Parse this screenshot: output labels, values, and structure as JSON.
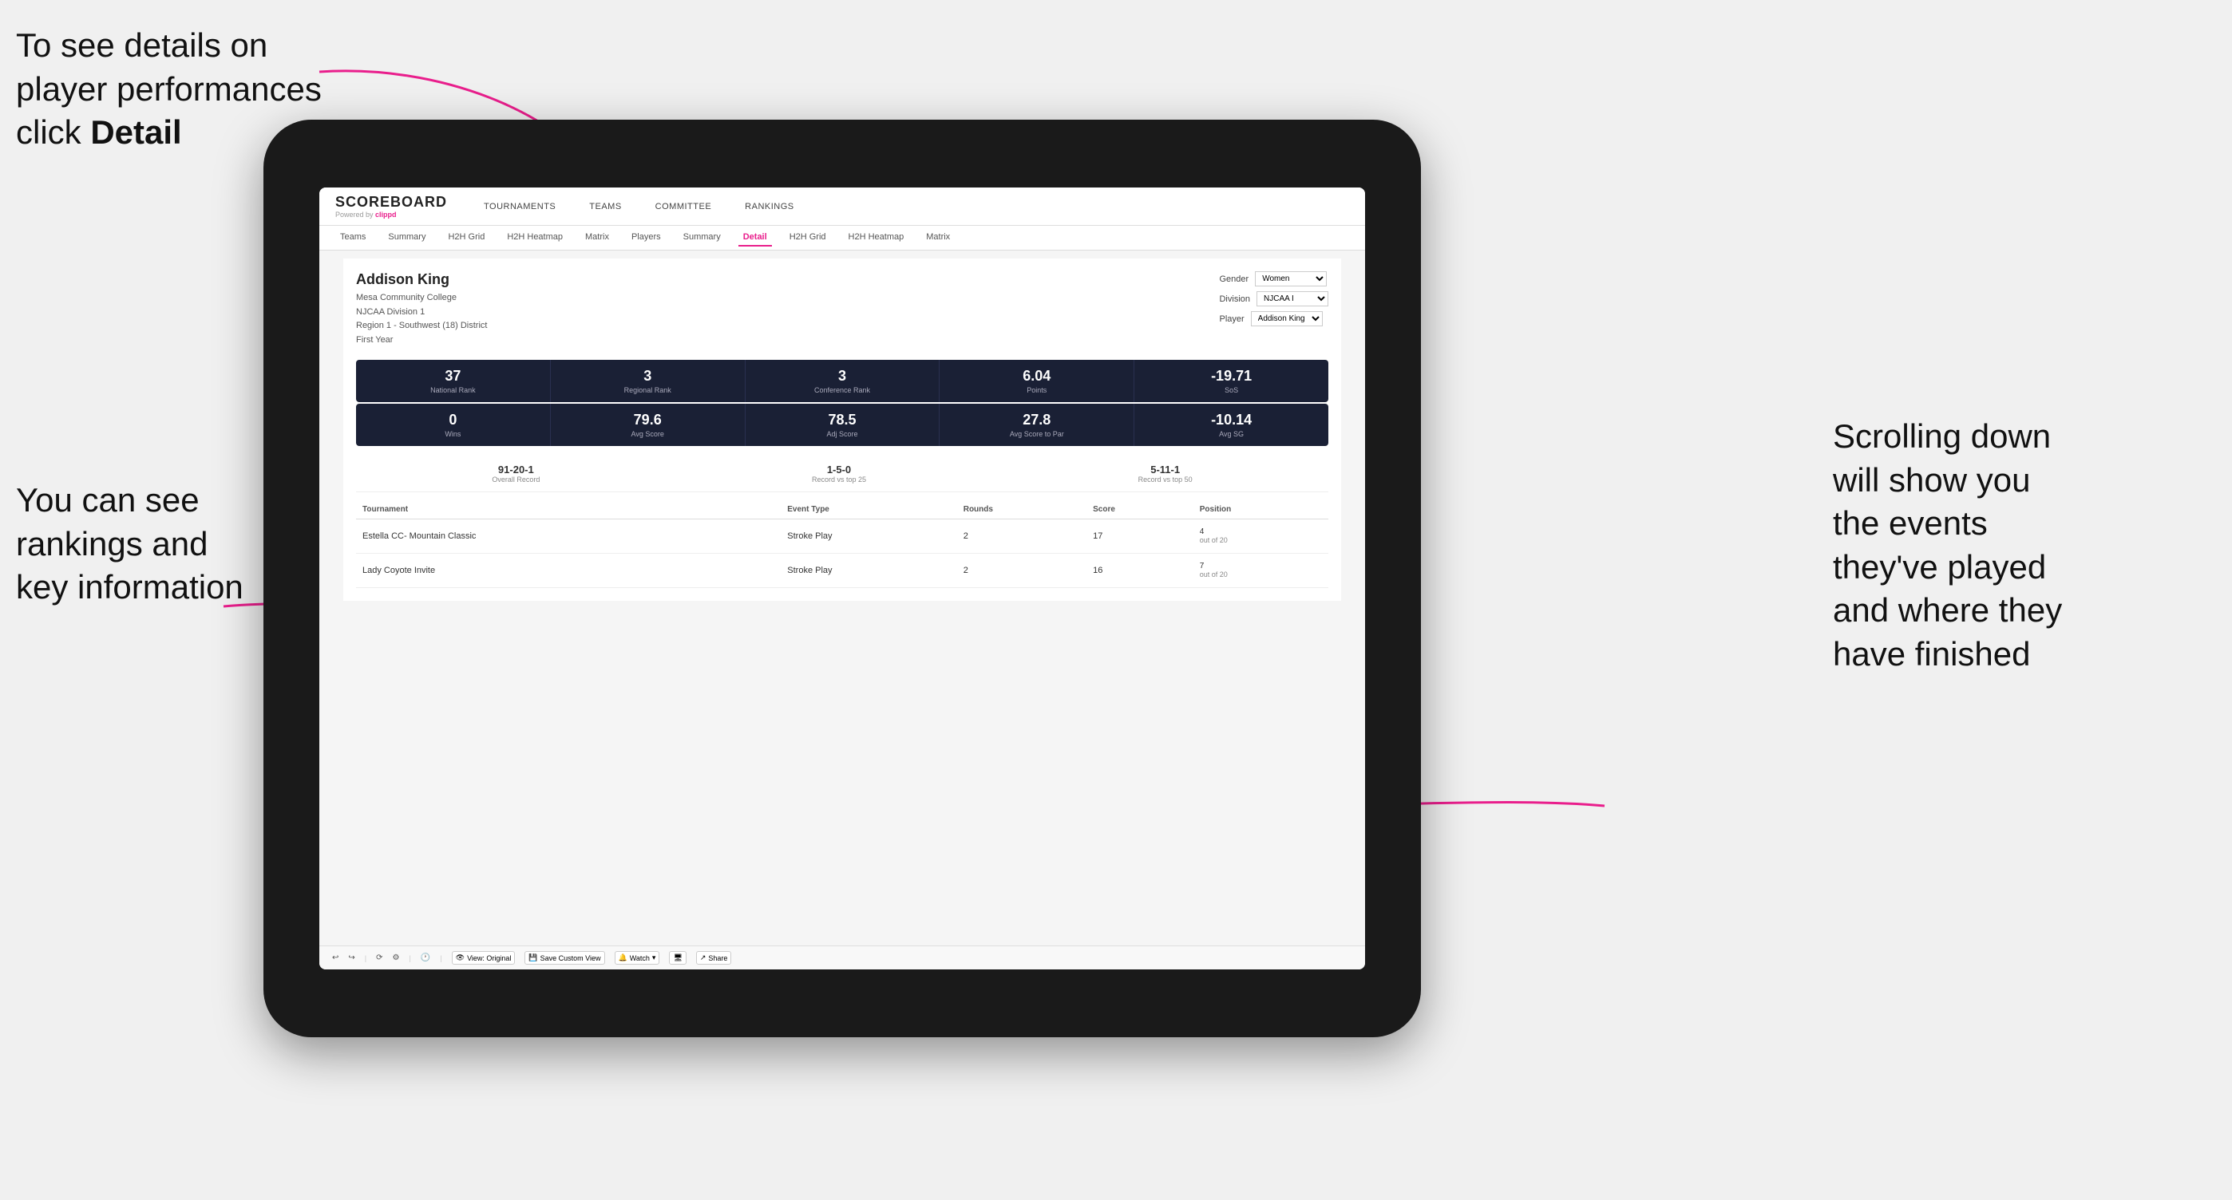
{
  "annotations": {
    "top_left": "To see details on\nplayer performances\nclick Detail",
    "bottom_left_line1": "You can see",
    "bottom_left_line2": "rankings and",
    "bottom_left_line3": "key information",
    "right_line1": "Scrolling down",
    "right_line2": "will show you",
    "right_line3": "the events",
    "right_line4": "they've played",
    "right_line5": "and where they",
    "right_line6": "have finished"
  },
  "nav": {
    "logo": "SCOREBOARD",
    "powered_by": "Powered by",
    "clippd": "clippd",
    "items": [
      "TOURNAMENTS",
      "TEAMS",
      "COMMITTEE",
      "RANKINGS"
    ]
  },
  "sub_nav": {
    "items": [
      "Teams",
      "Summary",
      "H2H Grid",
      "H2H Heatmap",
      "Matrix",
      "Players",
      "Summary",
      "Detail",
      "H2H Grid",
      "H2H Heatmap",
      "Matrix"
    ],
    "active": "Detail"
  },
  "player": {
    "name": "Addison King",
    "college": "Mesa Community College",
    "division": "NJCAA Division 1",
    "region": "Region 1 - Southwest (18) District",
    "year": "First Year",
    "gender_label": "Gender",
    "gender_value": "Women",
    "division_label": "Division",
    "division_value": "NJCAA I",
    "player_label": "Player",
    "player_value": "Addison King"
  },
  "stats_row1": [
    {
      "value": "37",
      "label": "National Rank"
    },
    {
      "value": "3",
      "label": "Regional Rank"
    },
    {
      "value": "3",
      "label": "Conference Rank"
    },
    {
      "value": "6.04",
      "label": "Points"
    },
    {
      "value": "-19.71",
      "label": "SoS"
    }
  ],
  "stats_row2": [
    {
      "value": "0",
      "label": "Wins"
    },
    {
      "value": "79.6",
      "label": "Avg Score"
    },
    {
      "value": "78.5",
      "label": "Adj Score"
    },
    {
      "value": "27.8",
      "label": "Avg Score to Par"
    },
    {
      "value": "-10.14",
      "label": "Avg SG"
    }
  ],
  "records": [
    {
      "value": "91-20-1",
      "label": "Overall Record"
    },
    {
      "value": "1-5-0",
      "label": "Record vs top 25"
    },
    {
      "value": "5-11-1",
      "label": "Record vs top 50"
    }
  ],
  "table": {
    "headers": [
      "Tournament",
      "",
      "Event Type",
      "Rounds",
      "Score",
      "Position"
    ],
    "rows": [
      {
        "tournament": "Estella CC- Mountain Classic",
        "event_type": "Stroke Play",
        "rounds": "2",
        "score": "17",
        "position": "4\nout of 20"
      },
      {
        "tournament": "Lady Coyote Invite",
        "event_type": "Stroke Play",
        "rounds": "2",
        "score": "16",
        "position": "7\nout of 20"
      }
    ]
  },
  "toolbar": {
    "view_label": "View: Original",
    "save_label": "Save Custom View",
    "watch_label": "Watch",
    "share_label": "Share"
  }
}
